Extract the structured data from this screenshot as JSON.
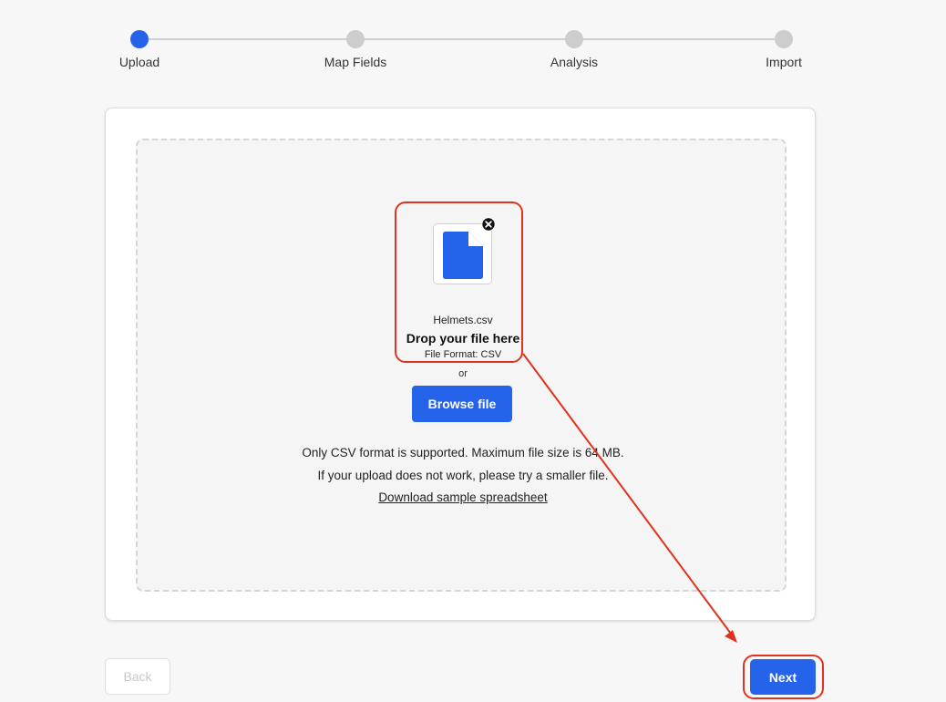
{
  "stepper": {
    "steps": [
      {
        "label": "Upload",
        "state": "active"
      },
      {
        "label": "Map Fields",
        "state": "pending"
      },
      {
        "label": "Analysis",
        "state": "pending"
      },
      {
        "label": "Import",
        "state": "pending"
      }
    ]
  },
  "upload": {
    "file_name": "Helmets.csv",
    "file_icon": "document-icon",
    "remove_icon": "close-circle-icon",
    "drop_title": "Drop your file here",
    "file_format": "File Format: CSV",
    "or_text": "or",
    "browse_label": "Browse file",
    "info_line_1": "Only CSV format is supported. Maximum file size is 64 MB.",
    "info_line_2": "If your upload does not work, please try a smaller file.",
    "download_link": "Download sample spreadsheet"
  },
  "footer": {
    "back_label": "Back",
    "back_disabled": true,
    "next_label": "Next"
  },
  "colors": {
    "accent": "#2563eb",
    "annotation": "#e0321e",
    "inactive_step": "#cdcdcd"
  }
}
